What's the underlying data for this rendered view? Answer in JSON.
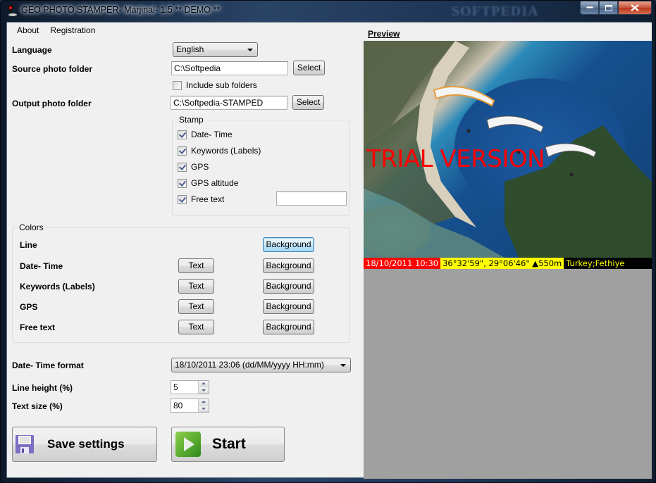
{
  "window": {
    "title": "GEO PHOTO STAMPER- Marjinal- 1.5 ** DEMO **",
    "watermark": "SOFTPEDIA",
    "controls": [
      "minimize",
      "maximize",
      "close"
    ]
  },
  "menu": {
    "items": [
      {
        "label": "About"
      },
      {
        "label": "Registration"
      }
    ]
  },
  "settings": {
    "language": {
      "label": "Language",
      "value": "English"
    },
    "source_folder": {
      "label": "Source photo folder",
      "value": "C:\\Softpedia",
      "button": "Select"
    },
    "include_subfolders": {
      "label": "Include sub folders",
      "checked": false
    },
    "output_folder": {
      "label": "Output photo folder",
      "value": "C:\\Softpedia-STAMPED",
      "button": "Select"
    },
    "stamp": {
      "title": "Stamp",
      "items": [
        {
          "label": "Date- Time",
          "checked": true
        },
        {
          "label": "Keywords (Labels)",
          "checked": true
        },
        {
          "label": "GPS",
          "checked": true
        },
        {
          "label": "GPS altitude",
          "checked": true
        },
        {
          "label": "Free text",
          "checked": true
        }
      ],
      "free_text_value": ""
    },
    "colors": {
      "title": "Colors",
      "text_button": "Text",
      "background_button": "Background",
      "rows": [
        {
          "label": "Line",
          "has_text": false
        },
        {
          "label": "Date- Time",
          "has_text": true
        },
        {
          "label": "Keywords (Labels)",
          "has_text": true
        },
        {
          "label": "GPS",
          "has_text": true
        },
        {
          "label": "Free text",
          "has_text": true
        }
      ]
    },
    "datetime_format": {
      "label": "Date- Time format",
      "value": "18/10/2011 23:06 (dd/MM/yyyy HH:mm)"
    },
    "line_height": {
      "label": "Line height (%)",
      "value": "5"
    },
    "text_size": {
      "label": "Text size (%)",
      "value": "80"
    },
    "save_button": "Save settings",
    "start_button": "Start"
  },
  "preview": {
    "title": "Preview",
    "overlay_text": "TRIAL VERSION",
    "stamp": {
      "datetime": "18/10/2011 10:30",
      "gps": "36°32'59\",  29°06'46\" ▲550m",
      "keywords": "Turkey;Fethiye"
    },
    "colors": {
      "datetime_bg": "#ff0000",
      "datetime_text": "#ffffff",
      "gps_bg": "#ffff00",
      "gps_text": "#000000",
      "line_bg": "#000000",
      "keywords_text": "#ffff00",
      "trial_text": "#ff0000"
    }
  }
}
